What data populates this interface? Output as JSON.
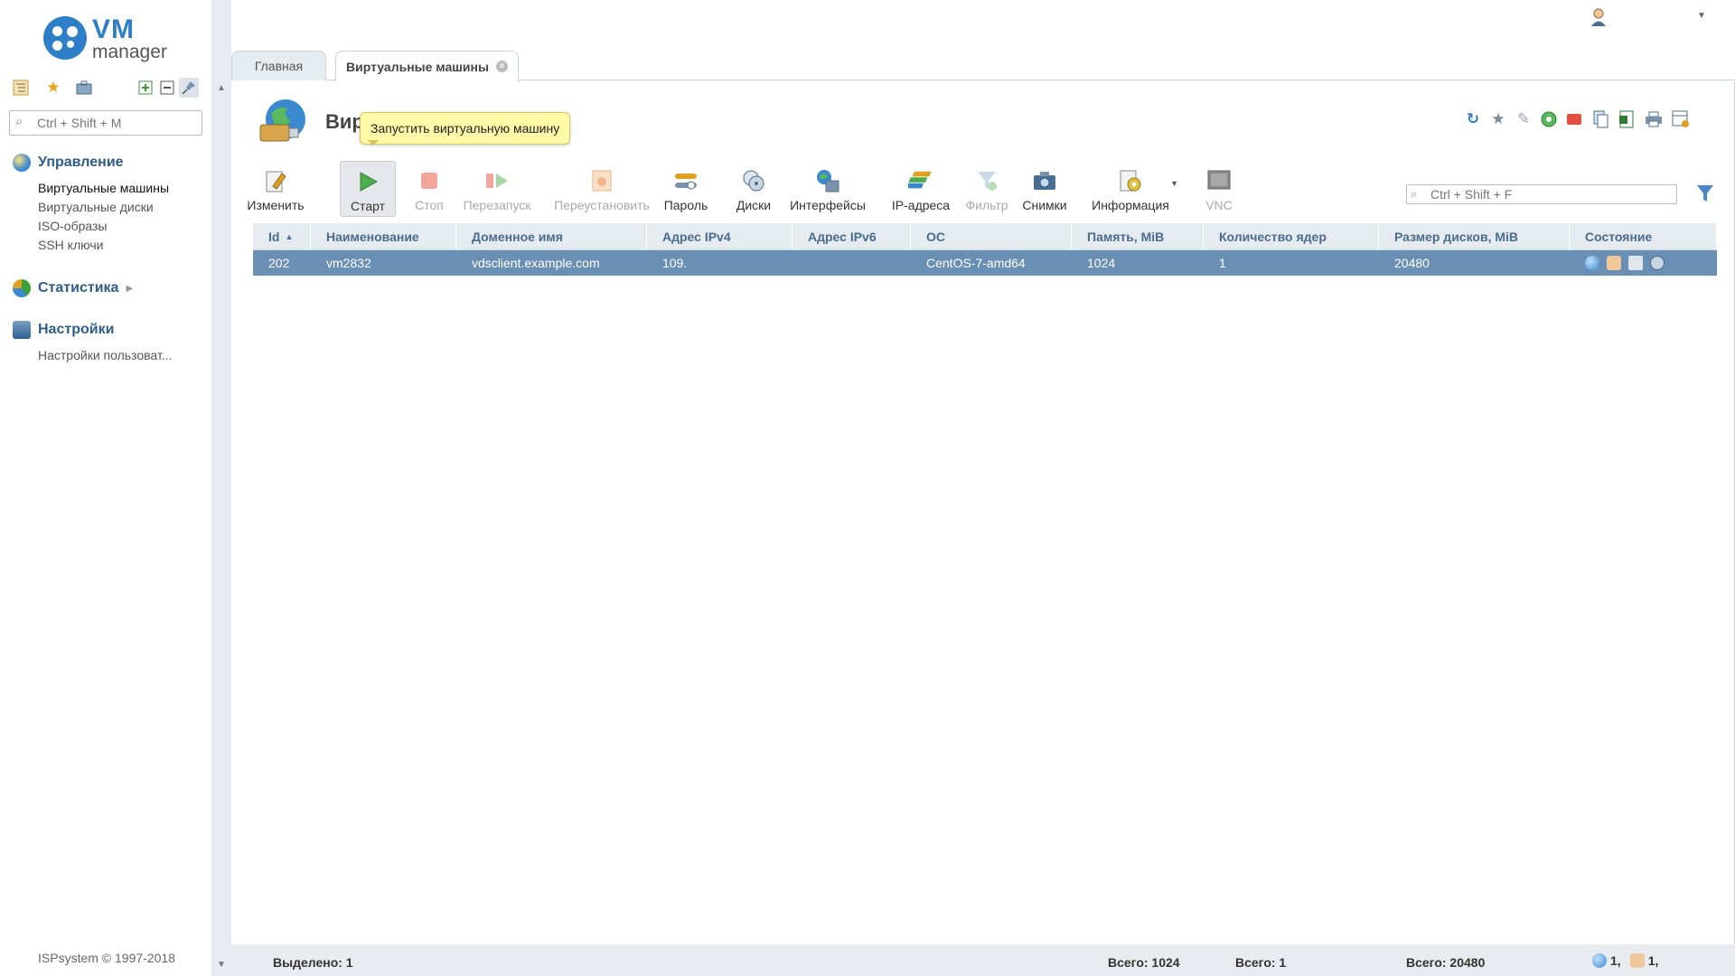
{
  "app": {
    "logo_text": "VM",
    "logo_subtext": "manager"
  },
  "sidebar": {
    "search_placeholder": "Ctrl + Shift + M",
    "groups": [
      {
        "title": "Управление",
        "items": [
          "Виртуальные машины",
          "Виртуальные диски",
          "ISO-образы",
          "SSH ключи"
        ]
      },
      {
        "title": "Статистика",
        "items": []
      },
      {
        "title": "Настройки",
        "items": [
          "Настройки пользоват..."
        ]
      }
    ],
    "copyright": "ISPsystem © 1997-2018"
  },
  "tabs": [
    {
      "label": "Главная"
    },
    {
      "label": "Виртуальные машины",
      "close": "×"
    }
  ],
  "page": {
    "title": "Вир",
    "tooltip": "Запустить виртуальную машину"
  },
  "toolbar": {
    "buttons": [
      {
        "label": "Изменить"
      },
      {
        "label": "Старт"
      },
      {
        "label": "Стоп"
      },
      {
        "label": "Перезапуск"
      },
      {
        "label": "Переустановить"
      },
      {
        "label": "Пароль"
      },
      {
        "label": "Диски"
      },
      {
        "label": "Интерфейсы"
      },
      {
        "label": "IP-адреса"
      },
      {
        "label": "Фильтр"
      },
      {
        "label": "Снимки"
      },
      {
        "label": "Информация"
      },
      {
        "label": "VNC"
      }
    ]
  },
  "grid_search": {
    "placeholder": "Ctrl + Shift + F"
  },
  "table": {
    "columns": [
      "Id",
      "Наименование",
      "Доменное имя",
      "Адрес IPv4",
      "Адрес IPv6",
      "ОС",
      "Память, MiB",
      "Количество ядер",
      "Размер дисков, MiB",
      "Состояние"
    ],
    "rows": [
      [
        "202",
        "vm2832",
        "vdsclient.example.com",
        "109.",
        "",
        "CentOS-7-amd64",
        "1024",
        "1",
        "20480",
        ""
      ]
    ]
  },
  "footer": {
    "selected": "Выделено: 1",
    "total_memory": "Всего: 1024",
    "total_cores": "Всего: 1",
    "total_disks": "Всего: 20480",
    "status_a": "1,",
    "status_b": "1,"
  },
  "colors": {
    "accent": "#2f7fc8",
    "selected_row": "#6a8fb5",
    "header_bg": "#e6ebf0",
    "tooltip_bg": "#fff9a8"
  }
}
